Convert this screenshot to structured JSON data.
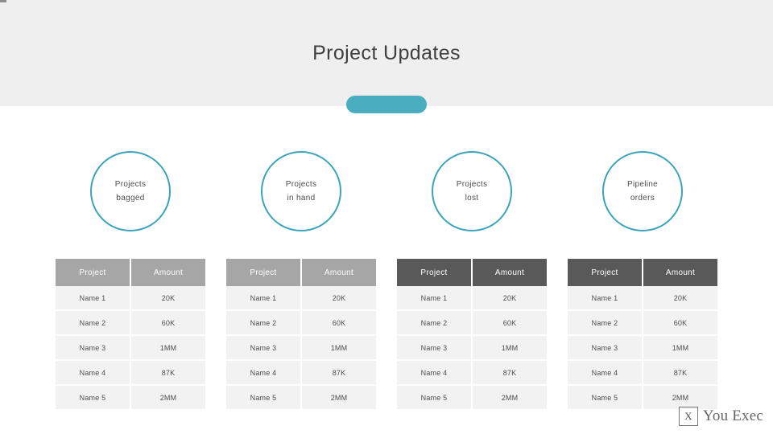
{
  "slide": {
    "title": "Project Updates",
    "corner_mark": "",
    "tab_label": ""
  },
  "columns": [
    {
      "circle_line1": "Projects",
      "circle_line2": "bagged",
      "header_style": "light",
      "headers": [
        "Project",
        "Amount"
      ],
      "rows": [
        [
          "Name 1",
          "20K"
        ],
        [
          "Name 2",
          "60K"
        ],
        [
          "Name 3",
          "1MM"
        ],
        [
          "Name 4",
          "87K"
        ],
        [
          "Name 5",
          "2MM"
        ]
      ]
    },
    {
      "circle_line1": "Projects",
      "circle_line2": "in hand",
      "header_style": "light",
      "headers": [
        "Project",
        "Amount"
      ],
      "rows": [
        [
          "Name 1",
          "20K"
        ],
        [
          "Name 2",
          "60K"
        ],
        [
          "Name 3",
          "1MM"
        ],
        [
          "Name 4",
          "87K"
        ],
        [
          "Name 5",
          "2MM"
        ]
      ]
    },
    {
      "circle_line1": "Projects",
      "circle_line2": "lost",
      "header_style": "dark",
      "headers": [
        "Project",
        "Amount"
      ],
      "rows": [
        [
          "Name 1",
          "20K"
        ],
        [
          "Name 2",
          "60K"
        ],
        [
          "Name 3",
          "1MM"
        ],
        [
          "Name 4",
          "87K"
        ],
        [
          "Name 5",
          "2MM"
        ]
      ]
    },
    {
      "circle_line1": "Pipeline",
      "circle_line2": "orders",
      "header_style": "dark",
      "headers": [
        "Project",
        "Amount"
      ],
      "rows": [
        [
          "Name 1",
          "20K"
        ],
        [
          "Name 2",
          "60K"
        ],
        [
          "Name 3",
          "1MM"
        ],
        [
          "Name 4",
          "87K"
        ],
        [
          "Name 5",
          "2MM"
        ]
      ]
    }
  ],
  "footer": {
    "logo_mark": "X",
    "logo_text": "You Exec"
  },
  "colors": {
    "accent": "#3ba4bb",
    "pill": "#4aadc0",
    "header_band": "#efefef",
    "header_light": "#a6a6a6",
    "header_dark": "#595959",
    "cell_bg": "#f2f2f2"
  }
}
